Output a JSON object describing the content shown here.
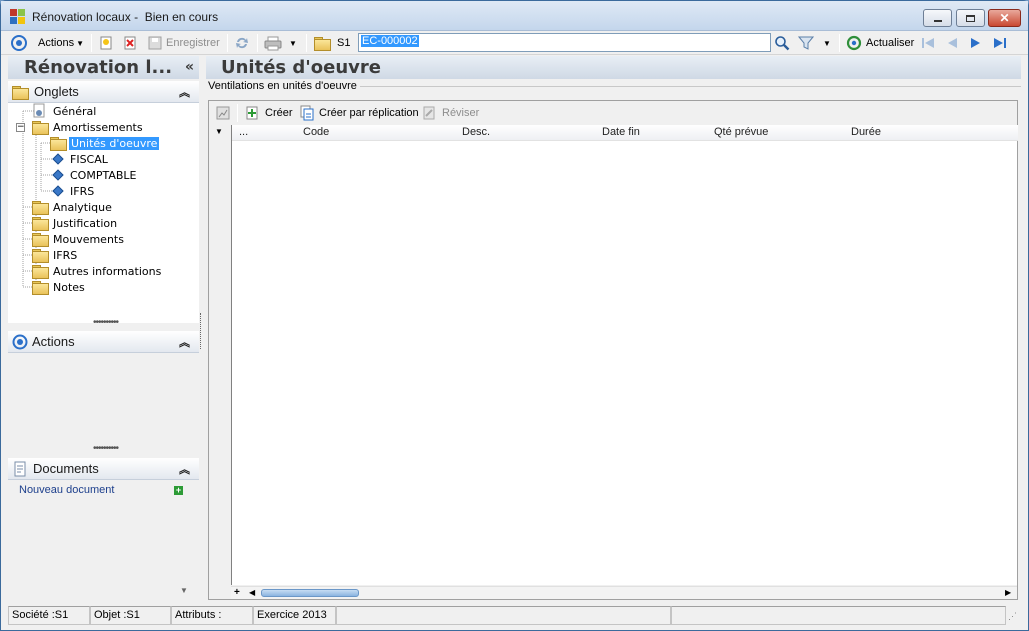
{
  "window": {
    "title": "Rénovation locaux -  Bien en cours"
  },
  "toolbar": {
    "actions_label": "Actions",
    "save_label": "Enregistrer",
    "s1_label": "S1",
    "code_value": "EC-000002",
    "refresh_label": "Actualiser"
  },
  "left": {
    "title": "Rénovation l...",
    "collapse_glyph": "«",
    "tabs_header": "Onglets",
    "tree": [
      {
        "label": "Général"
      },
      {
        "label": "Amortissements"
      },
      {
        "label": "Unités d'oeuvre"
      },
      {
        "label": "FISCAL"
      },
      {
        "label": "COMPTABLE"
      },
      {
        "label": "IFRS"
      },
      {
        "label": "Analytique"
      },
      {
        "label": "Justification"
      },
      {
        "label": "Mouvements"
      },
      {
        "label": "IFRS"
      },
      {
        "label": "Autres informations"
      },
      {
        "label": "Notes"
      }
    ],
    "actions_header": "Actions",
    "documents_header": "Documents",
    "new_document_label": "Nouveau document"
  },
  "main": {
    "title": "Unités d'oeuvre",
    "group_label": "Ventilations en unités d'oeuvre",
    "grid_toolbar": {
      "create_label": "Créer",
      "create_replication_label": "Créer par réplication",
      "revise_label": "Réviser"
    },
    "columns": [
      "...",
      "Code",
      "Desc.",
      "Date fin",
      "Qté prévue",
      "Durée"
    ]
  },
  "statusbar": {
    "societe": "Société :S1",
    "objet": "Objet :S1",
    "attributs": "Attributs :",
    "exercice": "Exercice 2013"
  },
  "colors": {
    "selection": "#3399ff",
    "folder": "#e9c25a",
    "accent_blue": "#2a6fc9"
  }
}
